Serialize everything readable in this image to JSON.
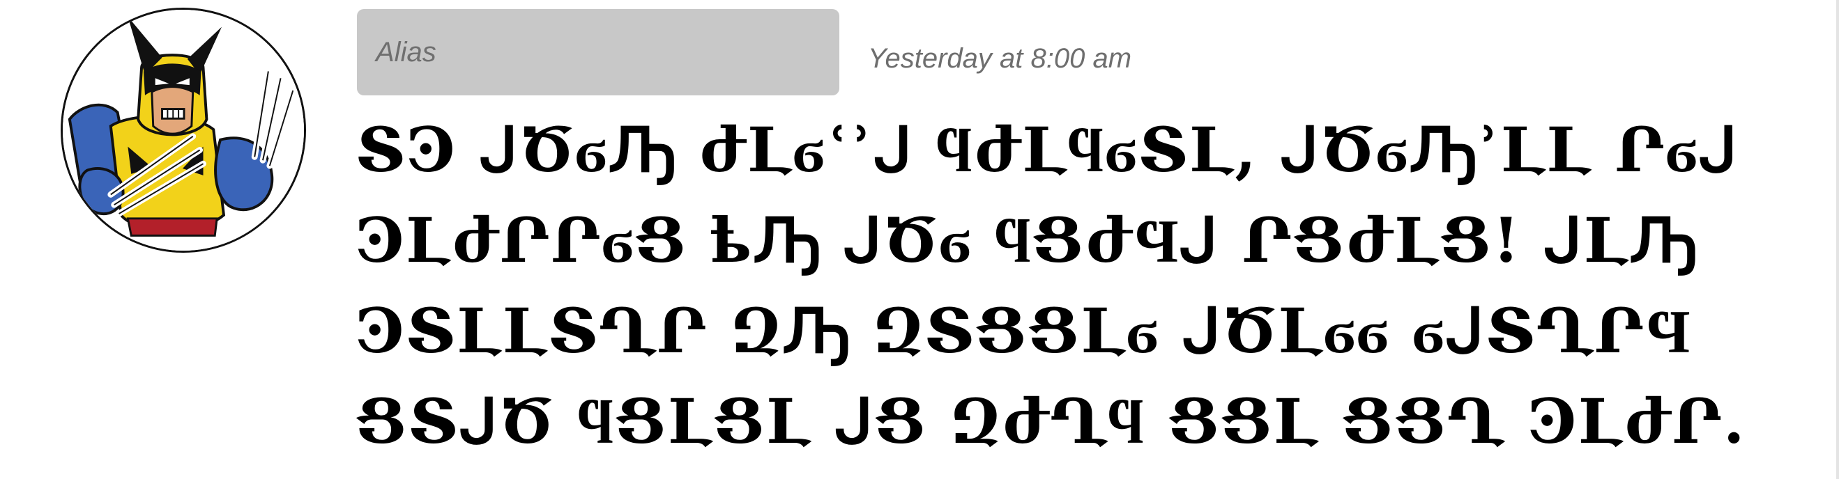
{
  "message": {
    "author": {
      "name": "Alias",
      "avatar_icon": "wolverine-avatar-icon"
    },
    "timestamp": "Yesterday at 8:00 am",
    "body_lines": [
      "ՏϿ ᒍԾϭԠ ժԼϭʿʾᒍ ϥժԼϥϭՏԼ, ᒍԾϭԠʾԼԼ Րϭᒍ",
      "ϿԼժՐՐϭՑ ҍԠ ᒍԾϭ ϥՑժϤᒍ ՐՑժԼՑ! ᒍԼԠ",
      "ϿՏԼԼՏՂՐ ԶԠ ԶՏՑՑԼϭ ᒍԾԼϭϭ ϭᒍՏՂՐϤ",
      "ՑՏᒍԾ ϥՑԼՑԼ ᒍՑ ԶժՂϥ ՑՑԼ ՑՑՂ ϿԼժՐ."
    ]
  },
  "colors": {
    "badge_bg": "#c8c8c8",
    "badge_text": "#6f6f6f",
    "timestamp_text": "#6e6e6e",
    "body_text": "#000000",
    "background": "#ffffff"
  }
}
